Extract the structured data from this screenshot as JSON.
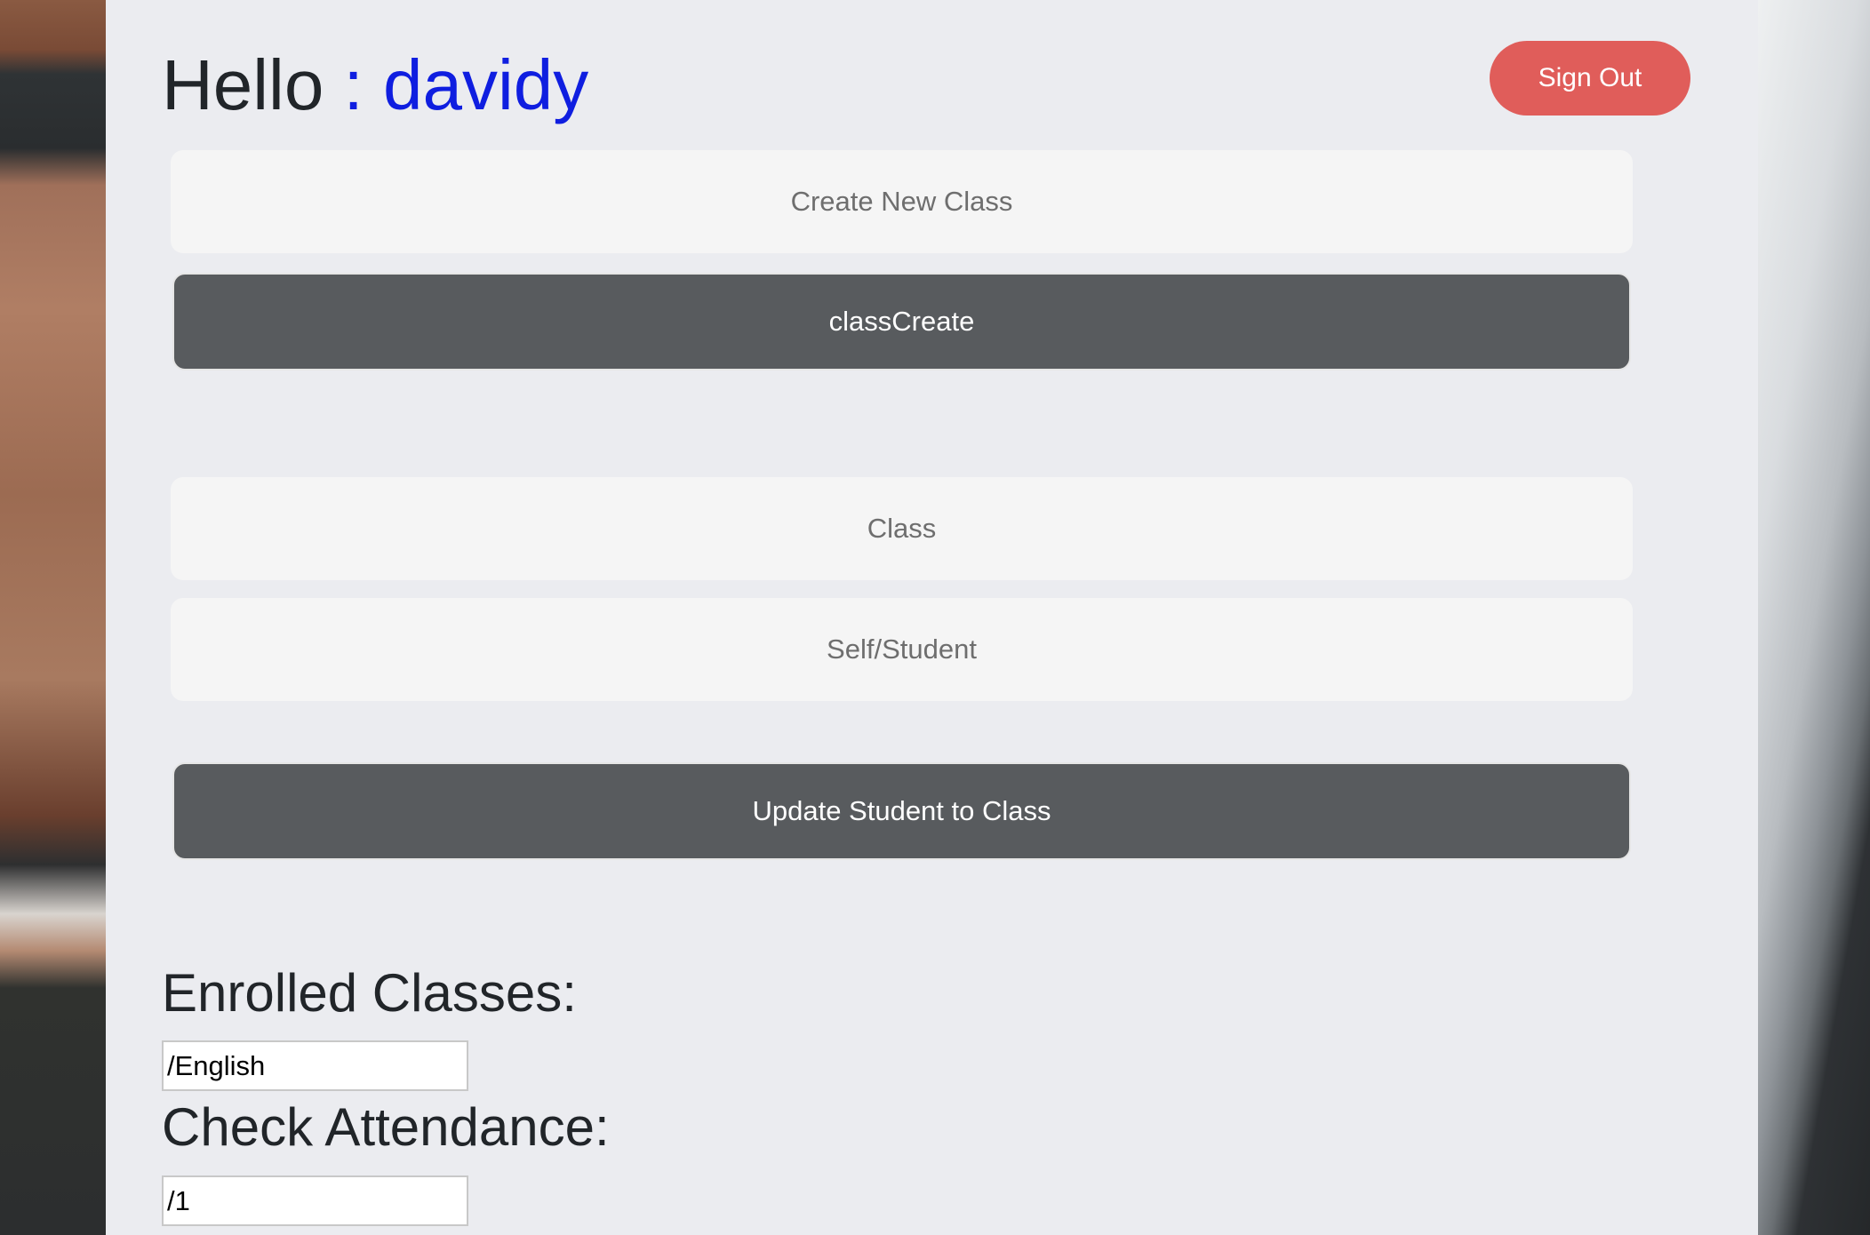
{
  "header": {
    "greeting": "Hello",
    "username": ": davidy",
    "signout_label": "Sign Out"
  },
  "create_class": {
    "input_placeholder": "Create New Class",
    "button_label": "classCreate"
  },
  "update_student": {
    "class_placeholder": "Class",
    "student_placeholder": "Self/Student",
    "button_label": "Update Student to Class"
  },
  "enrolled": {
    "heading": "Enrolled Classes:",
    "value": "/English"
  },
  "attendance": {
    "heading": "Check Attendance:",
    "value": "/1"
  },
  "colors": {
    "panel_bg": "#ebecf0",
    "username": "#0f1ee0",
    "signout_bg": "#e05d5a",
    "dark_button": "#585b5e"
  }
}
